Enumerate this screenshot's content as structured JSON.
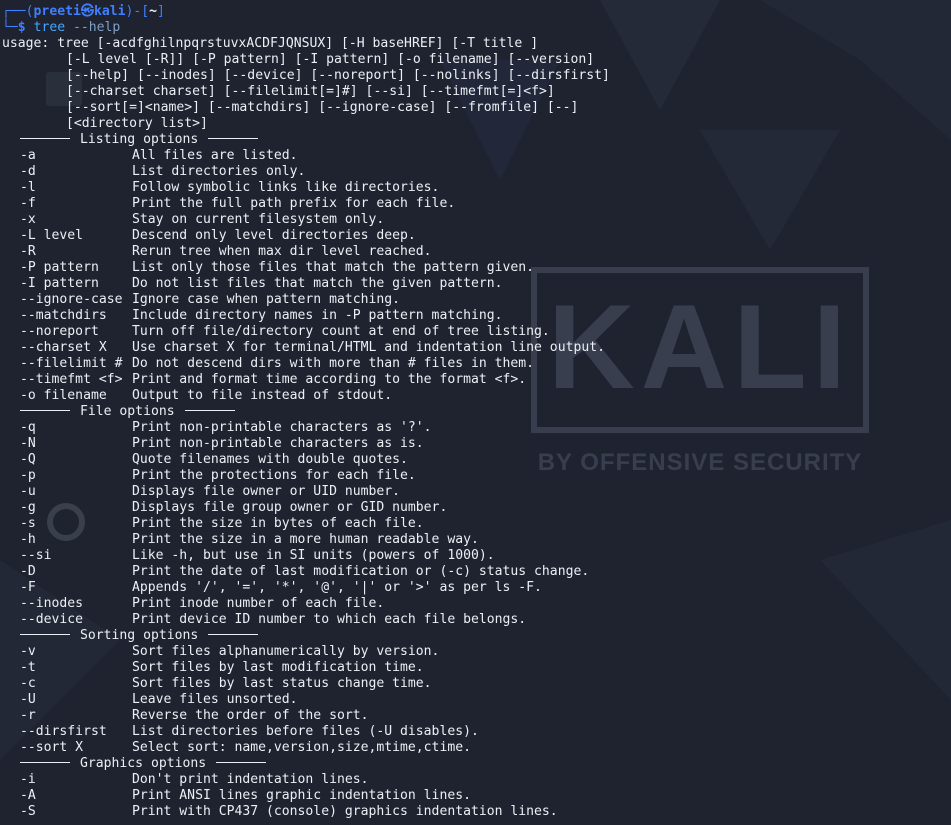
{
  "prompt": {
    "user": "preeti",
    "host": "kali",
    "path": "~",
    "command": "tree",
    "args": "--help"
  },
  "usage": {
    "label": "usage:",
    "lines": [
      "tree [-acdfghilnpqrstuvxACDFJQNSUX] [-H baseHREF] [-T title ]",
      "[-L level [-R]] [-P pattern] [-I pattern] [-o filename] [--version]",
      "[--help] [--inodes] [--device] [--noreport] [--nolinks] [--dirsfirst]",
      "[--charset charset] [--filelimit[=]#] [--si] [--timefmt[=]<f>]",
      "[--sort[=]<name>] [--matchdirs] [--ignore-case] [--fromfile] [--]",
      "[<directory list>]"
    ]
  },
  "sections": [
    {
      "title": "Listing options",
      "options": [
        {
          "flag": "-a",
          "desc": "All files are listed."
        },
        {
          "flag": "-d",
          "desc": "List directories only."
        },
        {
          "flag": "-l",
          "desc": "Follow symbolic links like directories."
        },
        {
          "flag": "-f",
          "desc": "Print the full path prefix for each file."
        },
        {
          "flag": "-x",
          "desc": "Stay on current filesystem only."
        },
        {
          "flag": "-L level",
          "desc": "Descend only level directories deep."
        },
        {
          "flag": "-R",
          "desc": "Rerun tree when max dir level reached."
        },
        {
          "flag": "-P pattern",
          "desc": "List only those files that match the pattern given."
        },
        {
          "flag": "-I pattern",
          "desc": "Do not list files that match the given pattern."
        },
        {
          "flag": "--ignore-case",
          "desc": "Ignore case when pattern matching."
        },
        {
          "flag": "--matchdirs",
          "desc": "Include directory names in -P pattern matching."
        },
        {
          "flag": "--noreport",
          "desc": "Turn off file/directory count at end of tree listing."
        },
        {
          "flag": "--charset X",
          "desc": "Use charset X for terminal/HTML and indentation line output."
        },
        {
          "flag": "--filelimit #",
          "desc": "Do not descend dirs with more than # files in them."
        },
        {
          "flag": "--timefmt <f>",
          "desc": "Print and format time according to the format <f>."
        },
        {
          "flag": "-o filename",
          "desc": "Output to file instead of stdout."
        }
      ]
    },
    {
      "title": "File options",
      "options": [
        {
          "flag": "-q",
          "desc": "Print non-printable characters as '?'."
        },
        {
          "flag": "-N",
          "desc": "Print non-printable characters as is."
        },
        {
          "flag": "-Q",
          "desc": "Quote filenames with double quotes."
        },
        {
          "flag": "-p",
          "desc": "Print the protections for each file."
        },
        {
          "flag": "-u",
          "desc": "Displays file owner or UID number."
        },
        {
          "flag": "-g",
          "desc": "Displays file group owner or GID number."
        },
        {
          "flag": "-s",
          "desc": "Print the size in bytes of each file."
        },
        {
          "flag": "-h",
          "desc": "Print the size in a more human readable way."
        },
        {
          "flag": "--si",
          "desc": "Like -h, but use in SI units (powers of 1000)."
        },
        {
          "flag": "-D",
          "desc": "Print the date of last modification or (-c) status change."
        },
        {
          "flag": "-F",
          "desc": "Appends '/', '=', '*', '@', '|' or '>' as per ls -F."
        },
        {
          "flag": "--inodes",
          "desc": "Print inode number of each file."
        },
        {
          "flag": "--device",
          "desc": "Print device ID number to which each file belongs."
        }
      ]
    },
    {
      "title": "Sorting options",
      "options": [
        {
          "flag": "-v",
          "desc": "Sort files alphanumerically by version."
        },
        {
          "flag": "-t",
          "desc": "Sort files by last modification time."
        },
        {
          "flag": "-c",
          "desc": "Sort files by last status change time."
        },
        {
          "flag": "-U",
          "desc": "Leave files unsorted."
        },
        {
          "flag": "-r",
          "desc": "Reverse the order of the sort."
        },
        {
          "flag": "--dirsfirst",
          "desc": "List directories before files (-U disables)."
        },
        {
          "flag": "--sort X",
          "desc": "Select sort: name,version,size,mtime,ctime."
        }
      ]
    },
    {
      "title": "Graphics options",
      "options": [
        {
          "flag": "-i",
          "desc": "Don't print indentation lines."
        },
        {
          "flag": "-A",
          "desc": "Print ANSI lines graphic indentation lines."
        },
        {
          "flag": "-S",
          "desc": "Print with CP437 (console) graphics indentation lines."
        }
      ]
    }
  ],
  "wallpaper": {
    "logo_text": "KALI",
    "tagline": "BY OFFENSIVE SECURITY"
  },
  "colors": {
    "background": "#1f2330",
    "prompt_blue": "#3f7fff",
    "text": "#eceff4",
    "watermark": "#3a4050"
  }
}
